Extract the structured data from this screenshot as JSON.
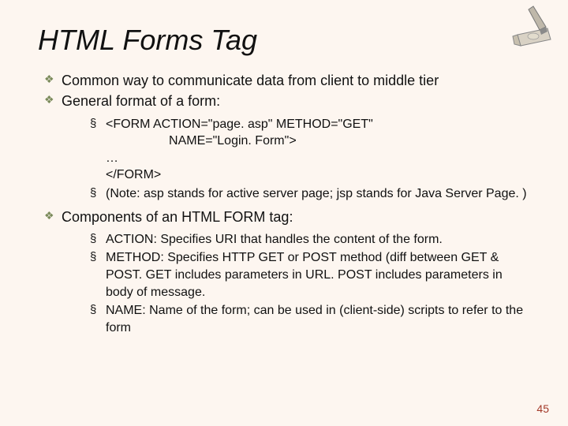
{
  "title": "HTML Forms Tag",
  "bullets": {
    "b1": "Common way to communicate data from client to middle tier",
    "b2": "General format of a form:",
    "b2sub": {
      "code": "<FORM ACTION=\"page. asp\" METHOD=\"GET\"\n                  NAME=\"Login. Form\">\n…\n</FORM>",
      "note": "(Note:  asp stands for active server page;  jsp stands for Java Server Page. )"
    },
    "b3": "Components of an HTML FORM tag:",
    "b3sub": {
      "s1": "ACTION: Specifies URI that handles the content of the form.",
      "s2": "METHOD: Specifies HTTP GET or POST method  (diff between GET & POST.  GET includes parameters in URL.  POST includes parameters in body of message.",
      "s3": "NAME: Name of the form; can be used in (client-side) scripts to refer to the form"
    }
  },
  "pageNumber": "45"
}
